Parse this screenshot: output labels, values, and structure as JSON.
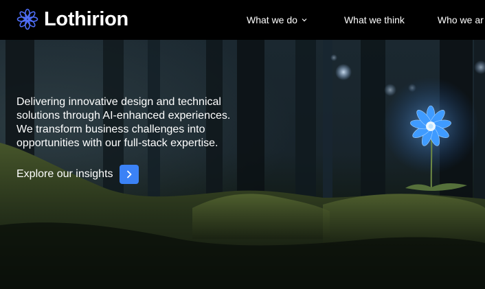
{
  "brand": {
    "name": "Lothirion",
    "logo_icon": "flower-icon",
    "accent": "#3b82f6"
  },
  "nav": {
    "items": [
      {
        "label": "What we do",
        "icon": "chevron-down-icon"
      },
      {
        "label": "What we think"
      },
      {
        "label": "Who we ar"
      }
    ]
  },
  "hero": {
    "tagline": "Delivering innovative design and technical solutions through AI-enhanced experiences. We transform business challenges into opportunities with our full-stack expertise.",
    "cta_label": "Explore our insights",
    "cta_icon": "chevron-right-icon",
    "background": "forest-with-glowing-blue-flower"
  }
}
